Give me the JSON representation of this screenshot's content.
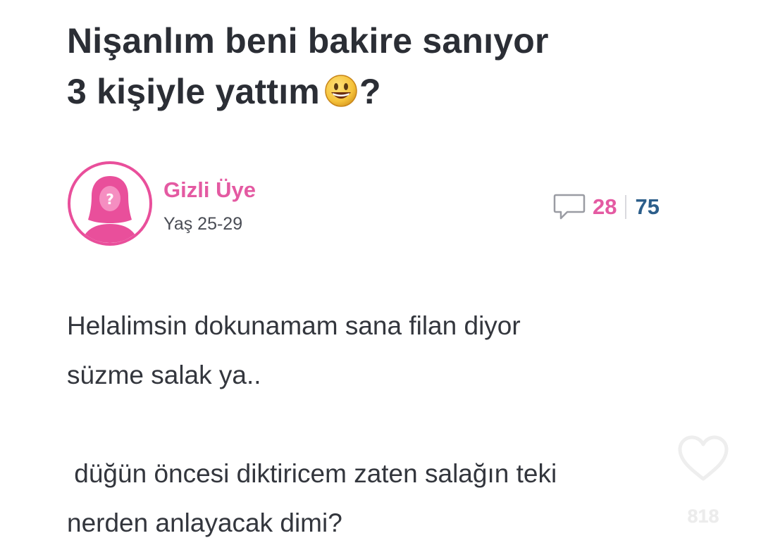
{
  "post": {
    "title_line1": "Nişanlım beni bakire sanıyor",
    "title_line2": "3 kişiyle yattım",
    "title_suffix": "?",
    "title_emoji": "grinning-face-emoji"
  },
  "author": {
    "name": "Gizli Üye",
    "age": "Yaş 25-29",
    "avatar_icon": "anonymous-female-avatar-icon",
    "avatar_color": "#e94f9b"
  },
  "stats": {
    "comment_icon": "comment-bubble-icon",
    "comments": "28",
    "views": "75",
    "comment_color": "#e45aa2",
    "view_color": "#2c5e8a"
  },
  "body": {
    "para1_line1": "Helalimsin dokunamam sana filan diyor",
    "para1_line2": "süzme salak ya..",
    "para2_line1": " düğün öncesi diktiricem zaten salağın teki",
    "para2_line2": "nerden anlayacak dimi?"
  },
  "overlay": {
    "like_icon": "heart-outline-icon",
    "like_count": "818"
  }
}
